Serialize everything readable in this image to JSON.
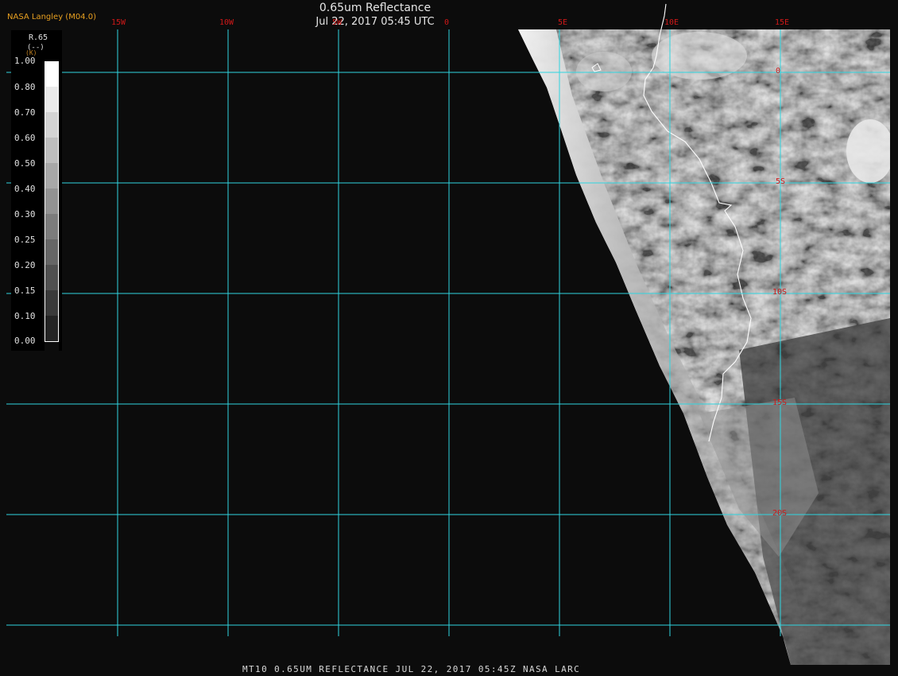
{
  "header": {
    "credit": "NASA Langley (M04.0)",
    "title": "0.65um Reflectance",
    "subtitle": "Jul 22, 2017 05:45 UTC"
  },
  "footer": {
    "caption": "MT10  0.65UM REFLECTANCE  JUL 22, 2017 05:45Z  NASA LARC"
  },
  "grid": {
    "line_color": "#2fd5e0",
    "label_color": "#d01818",
    "longitude_labels": [
      "15W",
      "10W",
      "5W",
      "0",
      "5E",
      "10E",
      "15E"
    ],
    "latitude_labels": [
      "0",
      "5S",
      "10S",
      "15S",
      "20S"
    ]
  },
  "legend": {
    "parameter": "R.65",
    "unit": "(--)",
    "k_label": "(K)",
    "ticks": [
      "1.00",
      "0.80",
      "0.70",
      "0.60",
      "0.50",
      "0.40",
      "0.30",
      "0.25",
      "0.20",
      "0.15",
      "0.10",
      "0.00"
    ],
    "segment_colors": [
      "#ffffff",
      "#eaeaea",
      "#d4d4d4",
      "#bebebe",
      "#a8a8a8",
      "#929292",
      "#7c7c7c",
      "#666666",
      "#505050",
      "#3a3a3a",
      "#242424",
      "#0c0c0c"
    ]
  },
  "colors": {
    "background": "#0c0c0c",
    "coastline": "#ffffff"
  }
}
